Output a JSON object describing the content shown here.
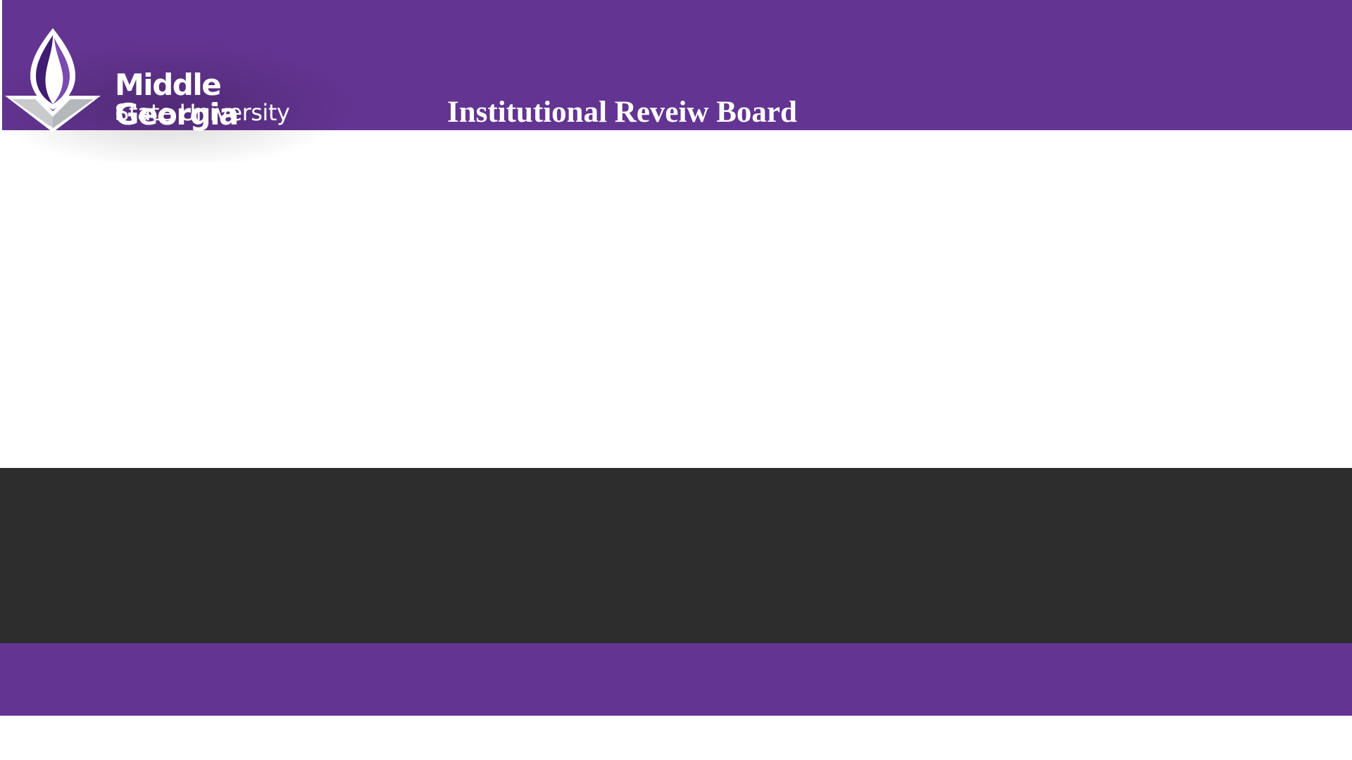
{
  "header": {
    "logo": {
      "line1": "Middle Georgia",
      "line2": "State University"
    },
    "title": "Institutional Reveiw Board"
  },
  "colors": {
    "brand_purple": "#633491",
    "dark_band": "#2d2d2d",
    "logo_gray": "#c8cacb",
    "logo_purple_dark": "#3f1d73",
    "logo_purple_light": "#7a4ab0"
  },
  "icons": {
    "logo_mark": "flame-torch-logo-icon"
  }
}
